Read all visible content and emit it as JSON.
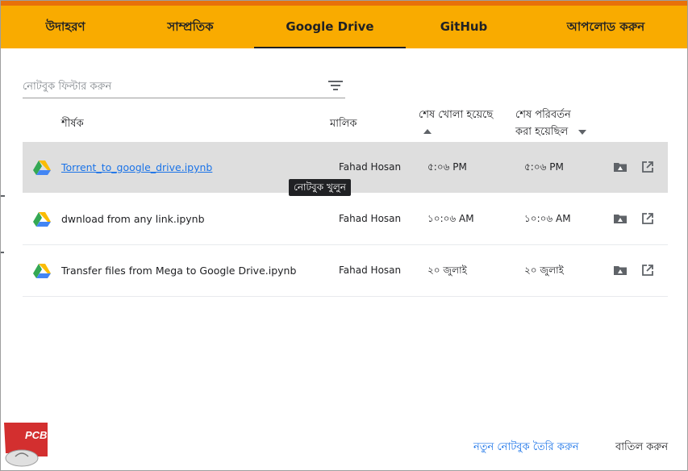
{
  "tabs": [
    {
      "label": "উদাহরণ",
      "active": false
    },
    {
      "label": "সাম্প্রতিক",
      "active": false
    },
    {
      "label": "Google Drive",
      "active": true
    },
    {
      "label": "GitHub",
      "active": false
    },
    {
      "label": "আপলোড করুন",
      "active": false
    }
  ],
  "filter": {
    "placeholder": "নোটবুক ফিল্টার করুন",
    "icon": "filter-list-icon"
  },
  "columns": {
    "title": "শীর্ষক",
    "owner": "মালিক",
    "last_opened": "শেষ খোলা হয়েছে",
    "last_modified_line1": "শেষ পরিবর্তন",
    "last_modified_line2": "করা হয়েছিল"
  },
  "rows": [
    {
      "title": "Torrent_to_google_drive.ipynb",
      "owner": "Fahad Hosan",
      "last_opened": "৫:০৬ PM",
      "last_modified": "৫:০৬ PM",
      "highlighted": true
    },
    {
      "title": "dwnload from any link.ipynb",
      "owner": "Fahad Hosan",
      "last_opened": "১০:০৬ AM",
      "last_modified": "১০:০৬ AM",
      "highlighted": false
    },
    {
      "title": "Transfer files from Mega to Google Drive.ipynb",
      "owner": "Fahad Hosan",
      "last_opened": "২০ জুলাই",
      "last_modified": "২০ জুলাই",
      "highlighted": false
    }
  ],
  "tooltip": "নোটবুক খুলুন",
  "footer": {
    "new_notebook": "নতুন নোটবুক তৈরি করুন",
    "cancel": "বাতিল করুন"
  },
  "logo_text": "PCB",
  "colors": {
    "accent_bar": "#e8710a",
    "tab_bg": "#f9ab00",
    "link": "#1a73e8",
    "row_highlight": "#dedede"
  }
}
